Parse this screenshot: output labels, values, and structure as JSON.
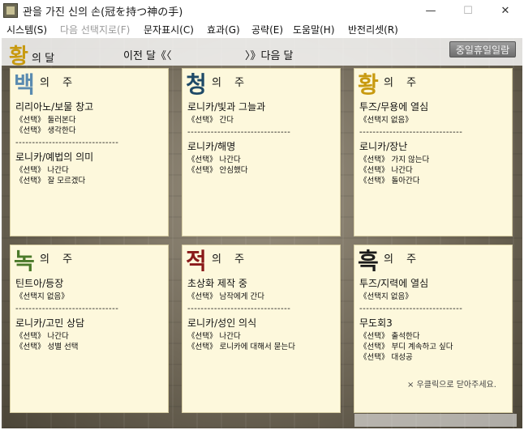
{
  "window": {
    "title": "관을 가진 신의 손(冠を持つ神の手)",
    "min_symbol": "—",
    "max_symbol": "☐",
    "close_symbol": "✕"
  },
  "menu": [
    {
      "label": "시스템(S)",
      "enabled": true
    },
    {
      "label": "다음 선택지로(F)",
      "enabled": false
    },
    {
      "label": "문자표시(C)",
      "enabled": true
    },
    {
      "label": "효과(G)",
      "enabled": true
    },
    {
      "label": "공략(E)",
      "enabled": true
    },
    {
      "label": "도움말(H)",
      "enabled": true
    },
    {
      "label": "반전리셋(R)",
      "enabled": true
    }
  ],
  "header": {
    "month_glyph": "황",
    "month_suffix": "의 달",
    "prev_month": "이전 달《〈",
    "next_month": "〉》다음 달",
    "holiday_button": "중일휴일일람"
  },
  "cards": [
    {
      "glyph": "백",
      "suffix": "의 주",
      "color": "#5a8bb0",
      "events": [
        {
          "title": "리리아노/보물 창고",
          "choices": [
            "《선택》 둘러본다",
            "《선택》 생각한다"
          ]
        },
        {
          "title": "로니카/예법의 의미",
          "choices": [
            "《선택》 나간다",
            "《선택》 잘 모르겠다"
          ]
        }
      ]
    },
    {
      "glyph": "청",
      "suffix": "의 주",
      "color": "#1f4a68",
      "events": [
        {
          "title": "로니카/빛과 그늘과",
          "choices": [
            "《선택》 간다"
          ]
        },
        {
          "title": "로니카/해명",
          "choices": [
            "《선택》 나간다",
            "《선택》 안심했다"
          ]
        }
      ]
    },
    {
      "glyph": "황",
      "suffix": "의 주",
      "color": "#c89a10",
      "events": [
        {
          "title": "투즈/무용에 열심",
          "choices": [
            "《선택지 없음》"
          ]
        },
        {
          "title": "로니카/장난",
          "choices": [
            "《선택》 가지 않는다",
            "《선택》 나간다",
            "《선택》 돌아간다"
          ]
        }
      ]
    },
    {
      "glyph": "녹",
      "suffix": "의 주",
      "color": "#4b7a2a",
      "events": [
        {
          "title": "틴트아/등장",
          "choices": [
            "《선택지 없음》"
          ]
        },
        {
          "title": "로니카/고민 상담",
          "choices": [
            "《선택》 나간다",
            "《선택》 성별 선택"
          ]
        }
      ]
    },
    {
      "glyph": "적",
      "suffix": "의 주",
      "color": "#8a1a1a",
      "events": [
        {
          "title": "초상화 제작 중",
          "choices": [
            "《선택》 남작에게 간다"
          ]
        },
        {
          "title": "로니카/성인 의식",
          "choices": [
            "《선택》 나간다",
            "《선택》 로니카에 대해서 묻는다"
          ]
        }
      ]
    },
    {
      "glyph": "흑",
      "suffix": "의 주",
      "color": "#1a1a1a",
      "events": [
        {
          "title": "투즈/지력에 열심",
          "choices": [
            "《선택지 없음》"
          ]
        },
        {
          "title": "무도회3",
          "choices": [
            "《선택》 출석한다",
            "《선택》 부디 계속하고 싶다",
            "《선택》 대성공"
          ]
        }
      ]
    }
  ],
  "separator": "-------------------------------",
  "footer": "× 우클릭으로 닫아주세요."
}
